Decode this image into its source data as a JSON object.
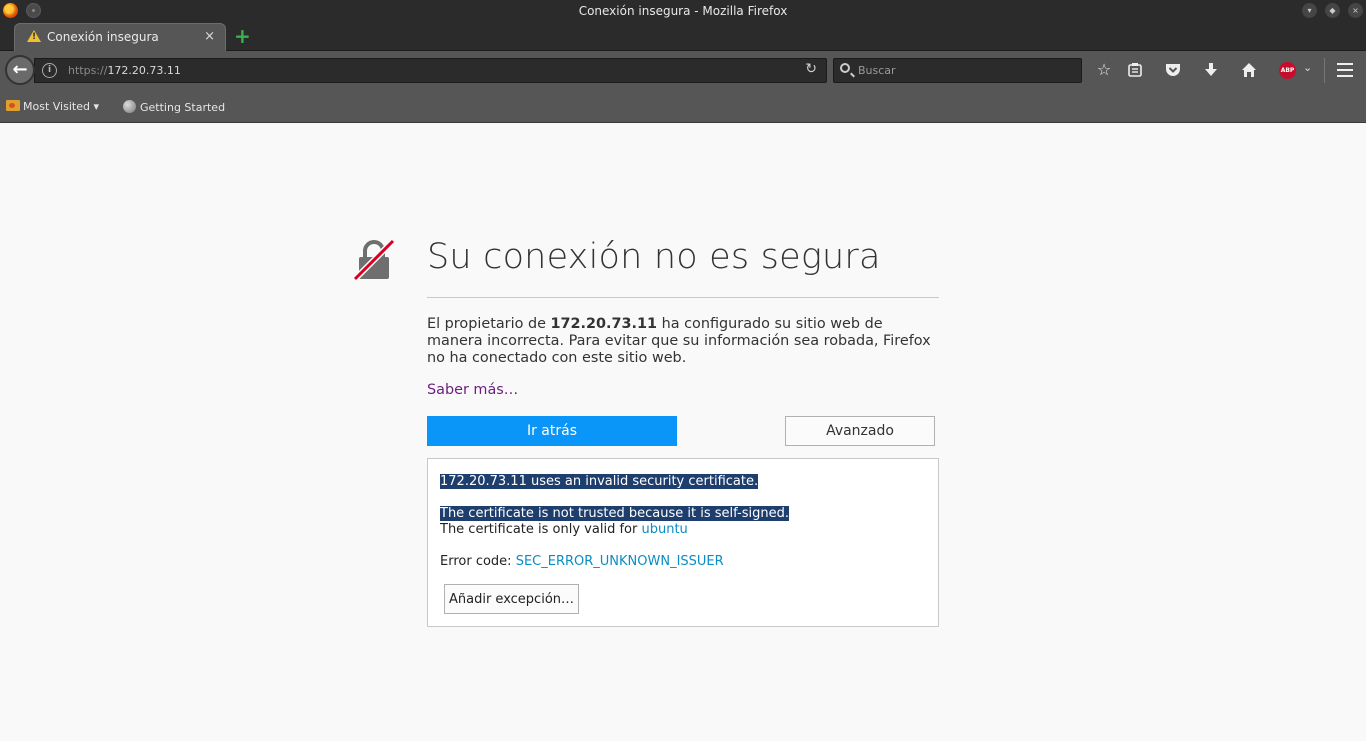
{
  "window": {
    "title": "Conexión insegura - Mozilla Firefox"
  },
  "tab": {
    "label": "Conexión insegura",
    "close": "×",
    "new_tab": "+"
  },
  "urlbar": {
    "scheme": "https://",
    "host": "172.20.73.11"
  },
  "searchbar": {
    "placeholder": "Buscar"
  },
  "bookmarks": [
    {
      "label": "Most Visited ▾"
    },
    {
      "label": "Getting Started"
    }
  ],
  "toolbar_icons": [
    "star-icon",
    "reading-list-icon",
    "pocket-icon",
    "download-icon",
    "home-icon",
    "adblock-icon",
    "menu-icon"
  ],
  "error_page": {
    "title": "Su conexión no es segura",
    "desc_pre": "El propietario de ",
    "desc_host": "172.20.73.11",
    "desc_post": " ha configurado su sitio web de manera incorrecta. Para evitar que su información sea robada, Firefox no ha conectado con este sitio web.",
    "learn_more": "Saber más…",
    "go_back": "Ir atrás",
    "advanced": "Avanzado",
    "adv_line1": "172.20.73.11 uses an invalid security certificate.",
    "adv_line2": "The certificate is not trusted because it is self-signed.",
    "adv_line3_pre": "The certificate is only valid for ",
    "adv_line3_host": "ubuntu",
    "error_code_label": "Error code: ",
    "error_code": "SEC_ERROR_UNKNOWN_ISSUER",
    "add_exception": "Añadir excepción…"
  },
  "colors": {
    "accent_button": "#0996f8",
    "selection": "#1e3f6e",
    "link": "#6b1f7c"
  }
}
